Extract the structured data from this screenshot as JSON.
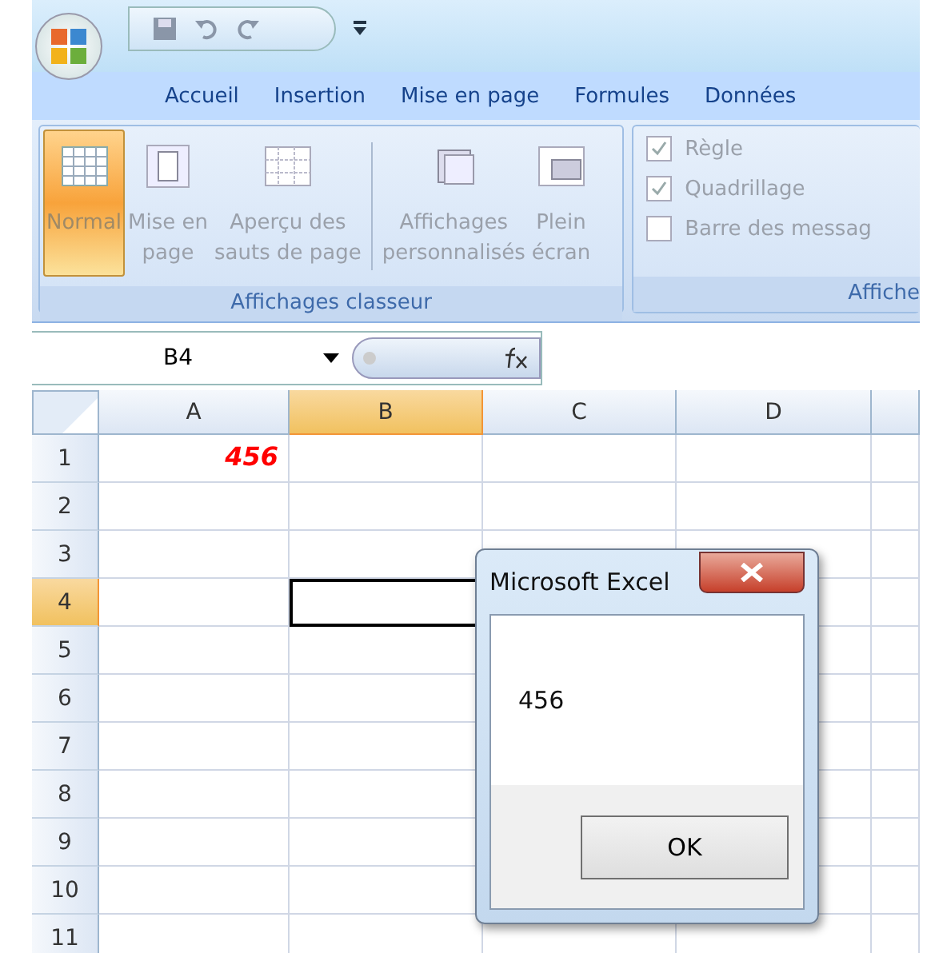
{
  "tabs": [
    {
      "label": "Accueil"
    },
    {
      "label": "Insertion"
    },
    {
      "label": "Mise en page"
    },
    {
      "label": "Formules"
    },
    {
      "label": "Données"
    }
  ],
  "ribbon": {
    "groups": [
      {
        "kind": "buttons",
        "label": "Affichages classeur",
        "items": [
          {
            "label": "Normal",
            "selected": true
          },
          {
            "label": "Mise en\npage",
            "selected": false
          },
          {
            "label": "Aperçu des\nsauts de page",
            "selected": false
          },
          {
            "label": "Affichages\npersonnalisés",
            "selected": false
          },
          {
            "label": "Plein\nécran",
            "selected": false
          }
        ]
      },
      {
        "kind": "checks",
        "label": "Affiche",
        "items": [
          {
            "label": "Règle",
            "checked": true
          },
          {
            "label": "Quadrillage",
            "checked": true
          },
          {
            "label": "Barre des messag",
            "checked": false
          }
        ]
      }
    ]
  },
  "name_box": {
    "value": "B4"
  },
  "sheet": {
    "columns": [
      {
        "label": "A",
        "selected": false
      },
      {
        "label": "B",
        "selected": true
      },
      {
        "label": "C",
        "selected": false
      },
      {
        "label": "D",
        "selected": false
      }
    ],
    "rows": [
      {
        "label": "1",
        "selected": false,
        "cells": [
          {
            "value": "456"
          }
        ]
      },
      {
        "label": "2",
        "selected": false
      },
      {
        "label": "3",
        "selected": false
      },
      {
        "label": "4",
        "selected": true
      },
      {
        "label": "5",
        "selected": false
      },
      {
        "label": "6",
        "selected": false
      },
      {
        "label": "7",
        "selected": false
      },
      {
        "label": "8",
        "selected": false
      },
      {
        "label": "9",
        "selected": false
      },
      {
        "label": "10",
        "selected": false
      },
      {
        "label": "11",
        "selected": false
      }
    ]
  },
  "dialog": {
    "title": "Microsoft Excel",
    "message": "456",
    "button": "OK"
  }
}
